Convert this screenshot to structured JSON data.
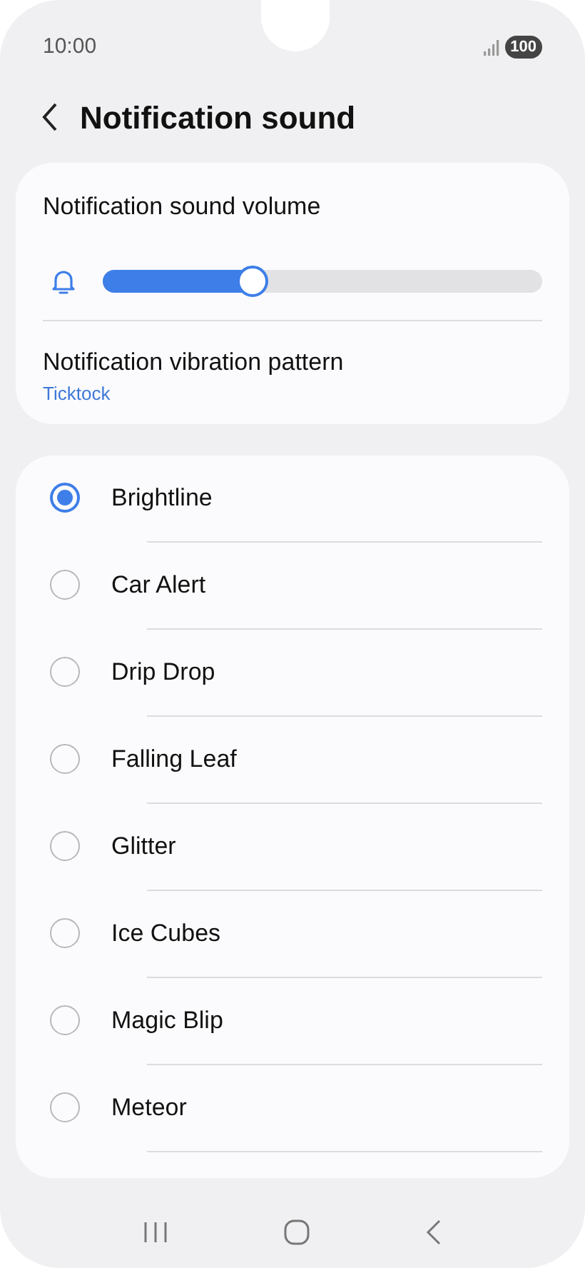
{
  "status_bar": {
    "time": "10:00",
    "battery": "100"
  },
  "header": {
    "title": "Notification sound"
  },
  "volume": {
    "label": "Notification sound volume",
    "level": 0.34
  },
  "vibration": {
    "label": "Notification vibration pattern",
    "value": "Ticktock"
  },
  "sounds": [
    {
      "name": "Brightline",
      "selected": true
    },
    {
      "name": "Car Alert",
      "selected": false
    },
    {
      "name": "Drip Drop",
      "selected": false
    },
    {
      "name": "Falling Leaf",
      "selected": false
    },
    {
      "name": "Glitter",
      "selected": false
    },
    {
      "name": "Ice Cubes",
      "selected": false
    },
    {
      "name": "Magic Blip",
      "selected": false
    },
    {
      "name": "Meteor",
      "selected": false
    }
  ]
}
